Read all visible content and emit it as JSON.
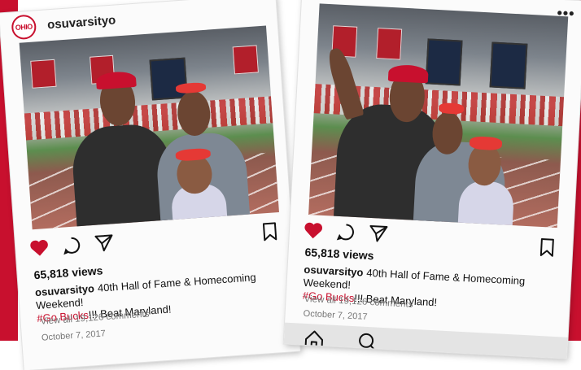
{
  "brand_colors": {
    "scarlet": "#c8102e",
    "gray": "#e4e4e4"
  },
  "post": {
    "username": "osuvarsityo",
    "avatar_logo": "OHIO",
    "views": "65,818 views",
    "caption_user": "osuvarsityo",
    "caption_text": "40th Hall of Fame & Homecoming Weekend!",
    "hashtag": "#Go Bucks",
    "caption_tail": "!!! Beat Maryland!",
    "view_all": "View all 19,126 comments",
    "date": "October 7, 2017"
  },
  "icons": {
    "like": "heart-icon",
    "comment": "comment-icon",
    "share": "send-icon",
    "save": "bookmark-icon",
    "more": "more-icon",
    "home": "home-icon",
    "search": "search-icon"
  }
}
